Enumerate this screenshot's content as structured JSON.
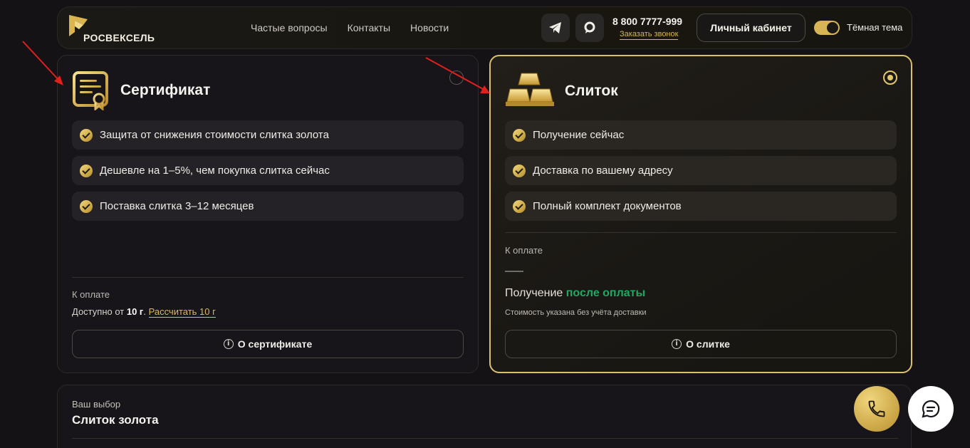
{
  "header": {
    "logo_text": "РОСВЕКСЕЛЬ",
    "nav": [
      "Частые вопросы",
      "Контакты",
      "Новости"
    ],
    "phone": "8 800 7777-999",
    "callback_label": "Заказать звонок",
    "cabinet_label": "Личный кабинет",
    "theme_label": "Тёмная тема",
    "theme_on": true
  },
  "certificate": {
    "title": "Сертификат",
    "selected": false,
    "features": [
      "Защита от снижения стоимости слитка золота",
      "Дешевле на 1–5%, чем покупка слитка сейчас",
      "Поставка слитка 3–12 месяцев"
    ],
    "payment_label": "К оплате",
    "avail_prefix": "Доступно от ",
    "avail_amount": "10 г",
    "avail_sep": ". ",
    "calc_link": "Рассчитать 10 г",
    "about_button": "О сертификате"
  },
  "bar": {
    "title": "Слиток",
    "selected": true,
    "features": [
      "Получение сейчас",
      "Доставка по вашему адресу",
      "Полный комплект документов"
    ],
    "payment_label": "К оплате",
    "receive_prefix": "Получение ",
    "receive_value": "после оплаты",
    "note": "Стоимость указана без учёта доставки",
    "about_button": "О слитке"
  },
  "choice": {
    "label": "Ваш выбор",
    "value": "Слиток золота"
  },
  "colors": {
    "accent_gold": "#d9c06e",
    "success_green": "#1fa862",
    "annotation_red": "#e0201b"
  }
}
